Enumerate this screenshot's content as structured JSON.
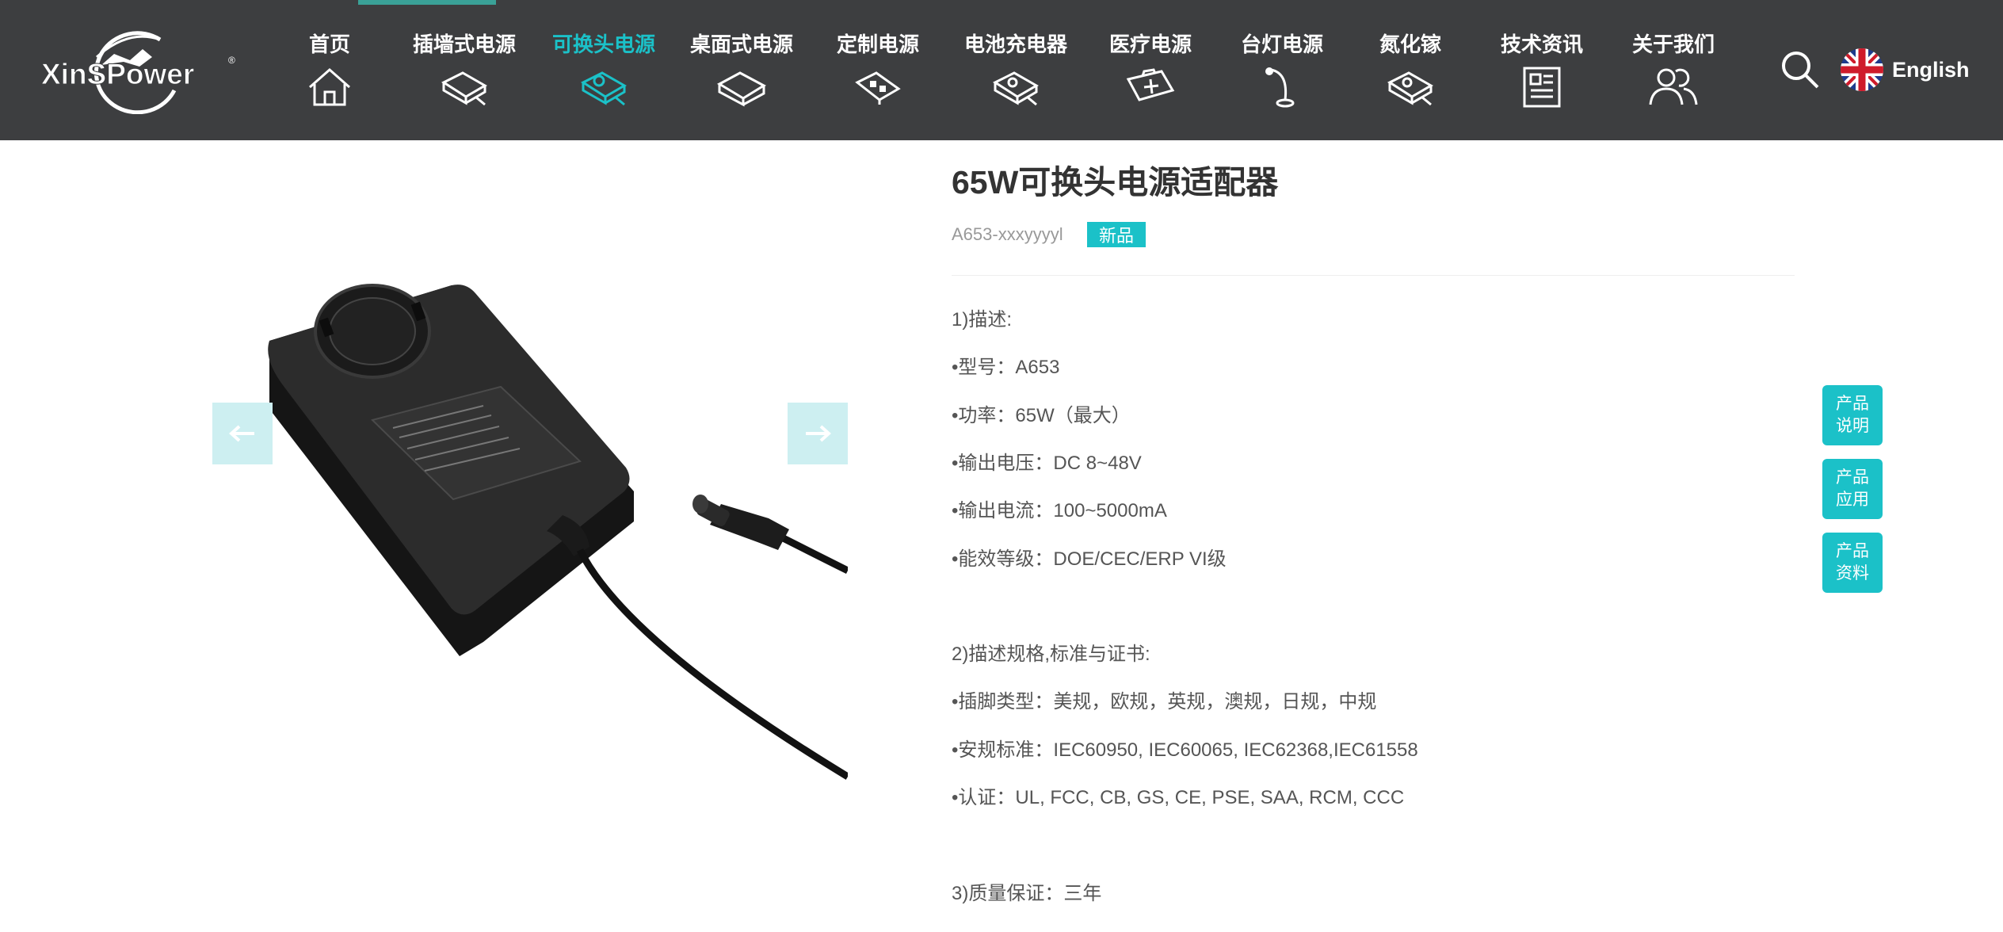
{
  "header": {
    "logo_text": "XinSPower",
    "nav": [
      {
        "label": "首页",
        "icon": "home-icon"
      },
      {
        "label": "插墙式电源",
        "icon": "wall-plug-adapter-icon"
      },
      {
        "label": "可换头电源",
        "icon": "interchangeable-plug-adapter-icon",
        "active": true
      },
      {
        "label": "桌面式电源",
        "icon": "desktop-adapter-icon"
      },
      {
        "label": "定制电源",
        "icon": "custom-power-board-icon"
      },
      {
        "label": "电池充电器",
        "icon": "battery-charger-icon"
      },
      {
        "label": "医疗电源",
        "icon": "medical-kit-icon"
      },
      {
        "label": "台灯电源",
        "icon": "desk-lamp-icon"
      },
      {
        "label": "氮化镓",
        "icon": "gan-charger-icon"
      },
      {
        "label": "技术资讯",
        "icon": "newspaper-icon"
      },
      {
        "label": "关于我们",
        "icon": "people-icon"
      }
    ],
    "language": "English"
  },
  "product": {
    "title": "65W可换头电源适配器",
    "sku": "A653-xxxyyyyl",
    "badge": "新品",
    "spec_lines": [
      "1)描述:",
      "•型号：A653",
      "•功率：65W（最大）",
      "•输出电压：DC 8~48V",
      "•输出电流：100~5000mA",
      "•能效等级：DOE/CEC/ERP VI级",
      "2)描述规格,标准与证书:",
      "•插脚类型：美规，欧规，英规，澳规，日规，中规",
      "•安规标准：IEC60950, IEC60065, IEC62368,IEC61558",
      "•认证：UL, FCC, CB, GS, CE, PSE, SAA, RCM, CCC",
      "3)质量保证：三年"
    ]
  },
  "side_buttons": [
    {
      "line1": "产品",
      "line2": "说明"
    },
    {
      "line1": "产品",
      "line2": "应用"
    },
    {
      "line1": "产品",
      "line2": "资料"
    }
  ],
  "colors": {
    "header_bg": "#3d3e40",
    "accent": "#1bc1c8",
    "arrow_bg": "#cdeff1"
  }
}
